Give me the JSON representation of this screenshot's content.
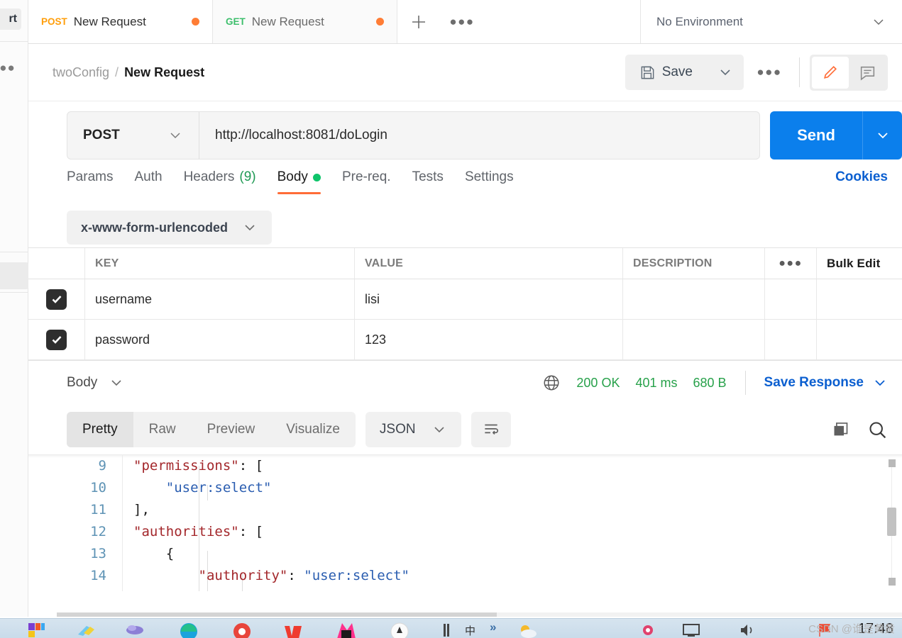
{
  "sidebar": {
    "import_label_clipped": "rt",
    "more_icon": "more-horizontal-icon"
  },
  "tabbar": {
    "tabs": [
      {
        "method": "POST",
        "name": "New Request",
        "unsaved": true,
        "active": true
      },
      {
        "method": "GET",
        "name": "New Request",
        "unsaved": true,
        "active": false
      }
    ],
    "new_tab_label": "+",
    "more_label": "●●●",
    "environment": "No Environment"
  },
  "header": {
    "breadcrumb_parent": "twoConfig",
    "breadcrumb_sep": "/",
    "breadcrumb_current": "New Request",
    "save_label": "Save",
    "save_caret_icon": "chevron-down-icon",
    "more_label": "●●●",
    "edit_icon": "pencil-icon",
    "comment_icon": "comment-icon"
  },
  "request": {
    "method": "POST",
    "method_caret_icon": "chevron-down-icon",
    "url": "http://localhost:8081/doLogin",
    "send_label": "Send",
    "send_caret_icon": "chevron-down-icon",
    "tabs": [
      {
        "label": "Params",
        "active": false
      },
      {
        "label": "Auth",
        "active": false
      },
      {
        "label": "Headers",
        "count": "(9)",
        "active": false
      },
      {
        "label": "Body",
        "dot": true,
        "active": true
      },
      {
        "label": "Pre-req.",
        "active": false
      },
      {
        "label": "Tests",
        "active": false
      },
      {
        "label": "Settings",
        "active": false
      }
    ],
    "cookies_label": "Cookies",
    "body_type": "x-www-form-urlencoded",
    "body_type_caret_icon": "chevron-down-icon"
  },
  "kv_table": {
    "headers": {
      "key": "KEY",
      "value": "VALUE",
      "description": "DESCRIPTION",
      "more": "●●●",
      "bulk_edit": "Bulk Edit"
    },
    "rows": [
      {
        "checked": true,
        "key": "username",
        "value": "lisi",
        "description": ""
      },
      {
        "checked": true,
        "key": "password",
        "value": "123",
        "description": ""
      }
    ]
  },
  "response": {
    "body_label": "Body",
    "body_caret_icon": "chevron-down-icon",
    "globe_icon": "globe-icon",
    "status": "200 OK",
    "time": "401 ms",
    "size": "680 B",
    "save_response_label": "Save Response",
    "save_response_caret_icon": "chevron-down-icon",
    "view_tabs": [
      {
        "label": "Pretty",
        "active": true
      },
      {
        "label": "Raw",
        "active": false
      },
      {
        "label": "Preview",
        "active": false
      },
      {
        "label": "Visualize",
        "active": false
      }
    ],
    "format": "JSON",
    "format_caret_icon": "chevron-down-icon",
    "wrap_icon": "wrap-lines-icon",
    "copy_icon": "copy-icon",
    "search_icon": "search-icon",
    "code": {
      "line_numbers": [
        "9",
        "10",
        "11",
        "12",
        "13",
        "14"
      ],
      "lines": [
        {
          "indent": 2,
          "tokens": [
            {
              "t": "key",
              "v": "\"permissions\""
            },
            {
              "t": "pun",
              "v": ": ["
            }
          ]
        },
        {
          "indent": 3,
          "tokens": [
            {
              "t": "str",
              "v": "\"user:select\""
            }
          ]
        },
        {
          "indent": 2,
          "tokens": [
            {
              "t": "pun",
              "v": "],"
            }
          ]
        },
        {
          "indent": 2,
          "tokens": [
            {
              "t": "key",
              "v": "\"authorities\""
            },
            {
              "t": "pun",
              "v": ": ["
            }
          ]
        },
        {
          "indent": 3,
          "tokens": [
            {
              "t": "pun",
              "v": "{"
            }
          ]
        },
        {
          "indent": 4,
          "tokens": [
            {
              "t": "key",
              "v": "\"authority\""
            },
            {
              "t": "pun",
              "v": ": "
            },
            {
              "t": "str",
              "v": "\"user:select\""
            }
          ]
        }
      ]
    }
  },
  "taskbar": {
    "ime_label": "中",
    "overflow_icon": "chevron-double-right-icon",
    "clock": "17:48"
  },
  "watermark": "CSDN @谁是黄黄",
  "colors": {
    "accent_orange": "#ff6c37",
    "send_blue": "#0b7fec",
    "link_blue": "#0b5fd0",
    "status_green": "#27a14a",
    "method_post": "#ff9e0a",
    "method_get": "#3dbf6c",
    "json_key": "#a3272b",
    "json_string": "#2a5db0"
  }
}
